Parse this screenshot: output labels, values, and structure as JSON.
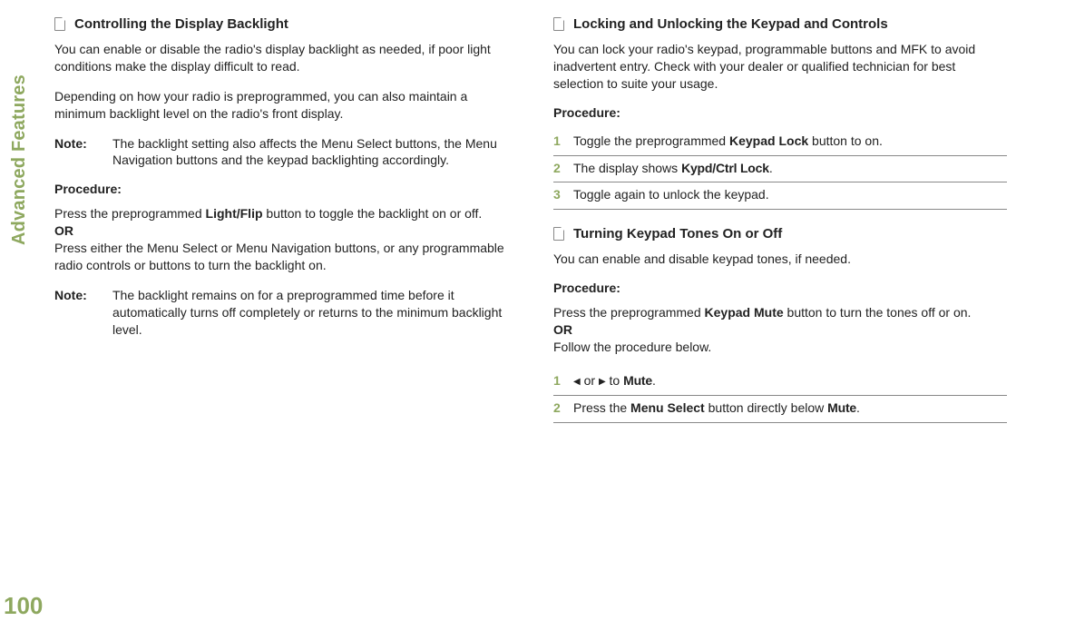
{
  "sideLabel": "Advanced Features",
  "pageNum": "100",
  "left": {
    "title": "Controlling the Display Backlight",
    "p1": "You can enable or disable the radio's display backlight as needed, if poor light conditions make the display difficult to read.",
    "p2": "Depending on how your radio is preprogrammed, you can also maintain a minimum backlight level on the radio's front display.",
    "noteLabel": "Note:",
    "note1": "The backlight setting also affects the Menu Select buttons, the Menu Navigation buttons and the keypad backlighting accordingly.",
    "proc": "Procedure:",
    "proc1a": "Press the preprogrammed ",
    "proc1b": "Light/Flip",
    "proc1c": " button to toggle the backlight on or off.",
    "or": "OR",
    "proc2": "Press either the Menu Select or Menu Navigation buttons, or any programmable radio controls or buttons to turn the backlight on.",
    "note2": "The backlight remains on for a preprogrammed time before it automatically turns off completely or returns to the minimum backlight level."
  },
  "rightA": {
    "title": "Locking and Unlocking the Keypad and Controls",
    "p1": "You can lock your radio's keypad, programmable buttons and MFK to avoid inadvertent entry. Check with your dealer or qualified technician for best selection to suite your usage.",
    "proc": "Procedure:",
    "s1a": "Toggle the preprogrammed ",
    "s1b": "Keypad Lock",
    "s1c": " button to on.",
    "s2a": "The display shows ",
    "s2b": "Kypd/Ctrl Lock",
    "s2c": ".",
    "s3": "Toggle again to unlock the keypad."
  },
  "rightB": {
    "title": "Turning Keypad Tones On or Off",
    "p1": "You can enable and disable keypad tones, if needed.",
    "proc": "Procedure:",
    "p2a": "Press the preprogrammed ",
    "p2b": "Keypad Mute",
    "p2c": " button to turn the tones off or on.",
    "or": "OR",
    "p3": "Follow the procedure below.",
    "s1mid": " or ",
    "s1to": " to ",
    "s1b": "Mute",
    "s1c": ".",
    "s2a": "Press the ",
    "s2b": "Menu Select",
    "s2c": " button directly below ",
    "s2d": "Mute",
    "s2e": "."
  }
}
